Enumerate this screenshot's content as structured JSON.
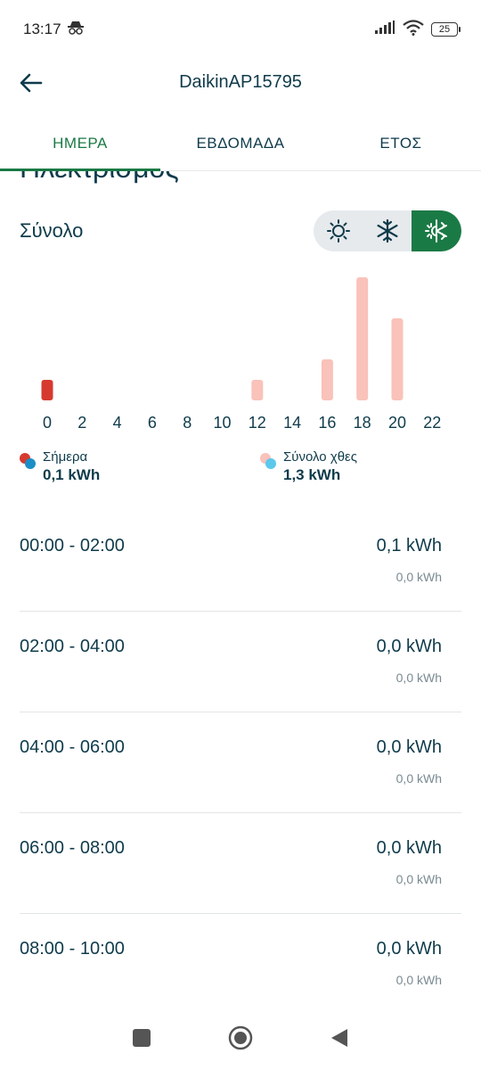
{
  "status": {
    "time": "13:17",
    "battery": "25"
  },
  "header": {
    "title": "DaikinAP15795"
  },
  "tabs": [
    {
      "label": "ΗΜΕΡΑ",
      "active": true
    },
    {
      "label": "ΕΒΔΟΜΑΔΑ",
      "active": false
    },
    {
      "label": "ΕΤΟΣ",
      "active": false
    }
  ],
  "section": {
    "title": "Ηλεκτρισμός"
  },
  "total": {
    "label": "Σύνολο"
  },
  "mode_toggle": [
    {
      "icon": "sun-icon",
      "active": false
    },
    {
      "icon": "snowflake-icon",
      "active": false
    },
    {
      "icon": "heat-cool-icon",
      "active": true
    }
  ],
  "chart_data": {
    "type": "bar",
    "categories": [
      "0",
      "2",
      "4",
      "6",
      "8",
      "10",
      "12",
      "14",
      "16",
      "18",
      "20",
      "22"
    ],
    "x_tick_labels": [
      "0",
      "2",
      "4",
      "6",
      "8",
      "10",
      "12",
      "14",
      "16",
      "18",
      "20",
      "22"
    ],
    "series": [
      {
        "name": "Σήμερα",
        "color": "#d63a2f",
        "values": [
          0.1,
          0,
          0,
          0,
          0,
          0,
          0,
          0,
          0,
          0,
          0,
          0
        ]
      },
      {
        "name": "Σύνολο χθες",
        "color": "#f9c2ba",
        "values": [
          0,
          0,
          0,
          0,
          0,
          0,
          0.1,
          0,
          0.2,
          0.6,
          0.4,
          0
        ]
      }
    ],
    "ylim": [
      0,
      0.6
    ],
    "grid": false
  },
  "legend": [
    {
      "label": "Σήμερα",
      "value": "0,1 kWh",
      "color_a": "#d63a2f",
      "color_b": "#1b8ec6"
    },
    {
      "label": "Σύνολο χθες",
      "value": "1,3 kWh",
      "color_a": "#f9c2ba",
      "color_b": "#5cc8ec"
    }
  ],
  "rows": [
    {
      "range": "00:00 - 02:00",
      "value": "0,1 kWh",
      "sub": "0,0 kWh"
    },
    {
      "range": "02:00 - 04:00",
      "value": "0,0 kWh",
      "sub": "0,0 kWh"
    },
    {
      "range": "04:00 - 06:00",
      "value": "0,0 kWh",
      "sub": "0,0 kWh"
    },
    {
      "range": "06:00 - 08:00",
      "value": "0,0 kWh",
      "sub": "0,0 kWh"
    },
    {
      "range": "08:00 - 10:00",
      "value": "0,0 kWh",
      "sub": "0,0 kWh"
    }
  ],
  "colors": {
    "accent": "#1a7a45",
    "text": "#0f3b4b"
  }
}
